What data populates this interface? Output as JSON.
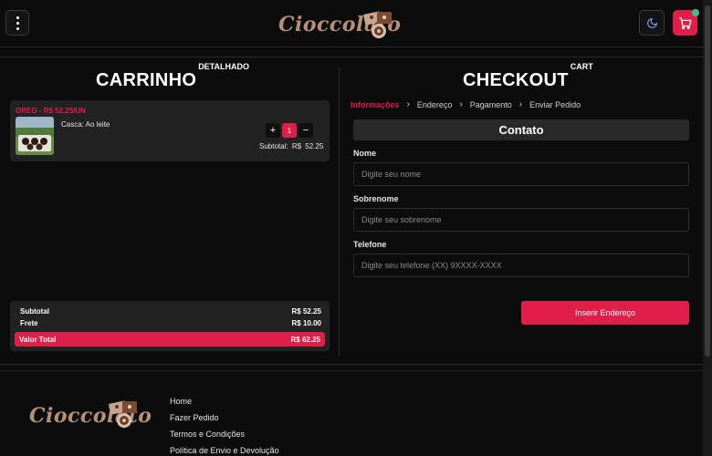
{
  "header": {
    "brand": "Cioccolato",
    "menu_icon": "dots-vertical-icon",
    "theme_icon": "moon-icon",
    "cart_icon": "cart-icon"
  },
  "cart": {
    "title": "CARRINHO",
    "title_sup": "DETALHADO",
    "item": {
      "name": "OREO - R$ 52,25/UN",
      "description": "Casca: Ao leite",
      "quantity": "1",
      "plus": "+",
      "minus": "−",
      "subtotal_label": "Subtotal:",
      "subtotal_value": "R$ 52.25"
    },
    "totals": {
      "subtotal_label": "Subtotal",
      "subtotal_value": "R$ 52.25",
      "frete_label": "Frete",
      "frete_value": "R$ 10.00",
      "total_label": "Valor Total",
      "total_value": "R$ 62.25"
    }
  },
  "checkout": {
    "title": "CHECKOUT",
    "title_sup": "CART",
    "steps": [
      "Informações",
      "Endereço",
      "Pagamento",
      "Enviar Pedido"
    ],
    "section": "Contato",
    "fields": {
      "nome_label": "Nome",
      "nome_placeholder": "Digite seu nome",
      "sobrenome_label": "Sobrenome",
      "sobrenome_placeholder": "Digite seu sobrenome",
      "telefone_label": "Telefone",
      "telefone_placeholder": "Digite seu telefone (XX) 9XXXX-XXXX"
    },
    "submit": "Inserir Endereço"
  },
  "footer": {
    "brand": "Cioccolato",
    "links": [
      "Home",
      "Fazer Pedido",
      "Termos e Condições",
      "Política de Envio e Devolução"
    ]
  },
  "colors": {
    "accent": "#e01e4a",
    "background": "#0d0c0c",
    "panel": "#232222",
    "brand": "#b88e79",
    "notification": "#3fbf8a"
  }
}
